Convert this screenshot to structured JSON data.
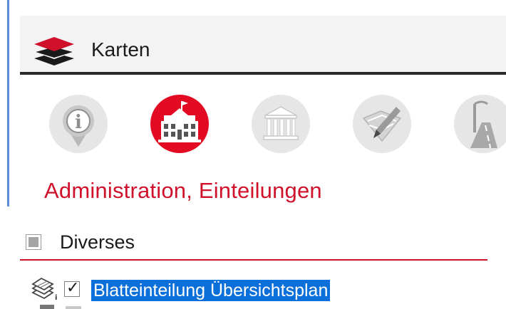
{
  "header": {
    "title": "Karten",
    "icon": "layers-icon"
  },
  "categories": [
    {
      "name": "info",
      "icon": "info-icon",
      "active": false
    },
    {
      "name": "administration",
      "icon": "town-hall-icon",
      "active": true
    },
    {
      "name": "public-building",
      "icon": "columns-building-icon",
      "active": false
    },
    {
      "name": "planning",
      "icon": "map-pencil-icon",
      "active": false
    },
    {
      "name": "roads",
      "icon": "road-lamp-icon",
      "active": false
    }
  ],
  "section": {
    "heading": "Administration, Einteilungen"
  },
  "group": {
    "label": "Diverses",
    "state": "partial"
  },
  "layers": [
    {
      "label": "Blatteinteilung Übersichtsplan",
      "checked": true,
      "selected": true
    }
  ],
  "colors": {
    "accent_red": "#d0112b",
    "selection_blue": "#0a6fd9",
    "left_accent_blue": "#5b8fd6",
    "header_bg": "#f3f3f3"
  }
}
